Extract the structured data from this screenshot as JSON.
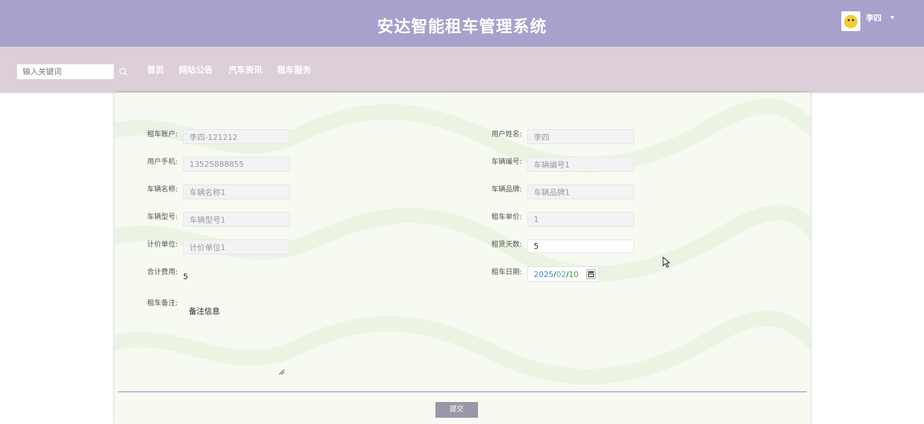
{
  "header": {
    "title": "安达智能租车管理系统",
    "user_name": "李四",
    "user_avatar_icon": "duck-avatar-icon"
  },
  "nav": {
    "search_placeholder": "输入关键词",
    "search_icon": "search-icon",
    "items": [
      "首页",
      "网站公告",
      "汽车资讯",
      "租车服务"
    ]
  },
  "form": {
    "account_label": "租车账户:",
    "account_value": "李四-121212",
    "username_label": "用户姓名:",
    "username_value": "李四",
    "phone_label": "用户手机:",
    "phone_value": "13525888855",
    "vehicle_no_label": "车辆编号:",
    "vehicle_no_value": "车辆编号1",
    "vehicle_name_label": "车辆名称:",
    "vehicle_name_value": "车辆名称1",
    "brand_label": "车辆品牌:",
    "brand_value": "车辆品牌1",
    "model_label": "车辆型号:",
    "model_value": "车辆型号1",
    "price_label": "租车单价:",
    "price_value": "1",
    "unit_label": "计价单位:",
    "unit_value": "计价单位1",
    "days_label": "租赁天数:",
    "days_value": "5",
    "total_label": "合计费用:",
    "total_value": "5",
    "date_label": "租车日期:",
    "date_year": "2025",
    "date_month": "02",
    "date_day": "10",
    "date_sep": "/",
    "remark_label": "租车备注:",
    "remark_value": "备注信息",
    "submit_label": "提交"
  },
  "colors": {
    "header_bg": "#a8a1cc",
    "nav_bg": "#dccfd8",
    "divider": "#8b83bf",
    "submit_bg": "#9a98a8"
  }
}
